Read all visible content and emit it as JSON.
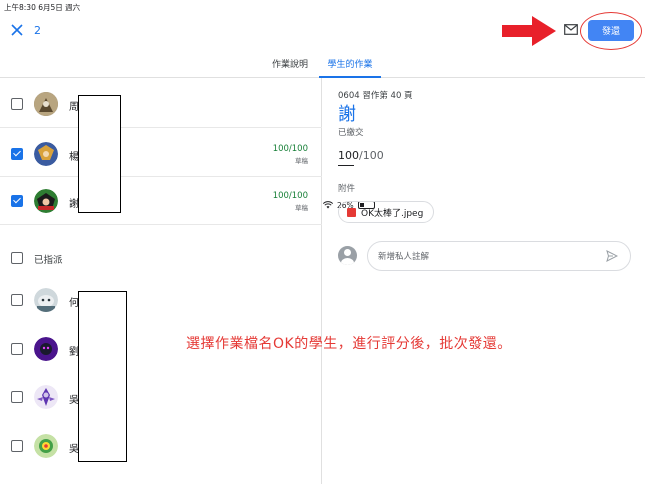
{
  "status_bar": {
    "time": "上午8:30  6月5日 週六",
    "battery": "26%"
  },
  "top_bar": {
    "selected_count": "2",
    "return_label": "發還"
  },
  "tabs": [
    {
      "label": "作業說明"
    },
    {
      "label": "學生的作業"
    }
  ],
  "students": [
    {
      "name": "周",
      "checked": false,
      "grade": "",
      "note": ""
    },
    {
      "name": "楊",
      "checked": true,
      "grade": "100/100",
      "note": "草稿"
    },
    {
      "name": "謝",
      "checked": true,
      "grade": "100/100",
      "note": "草稿"
    }
  ],
  "assigned_group": {
    "label": "已指派"
  },
  "assigned_students": [
    {
      "name": "何",
      "checked": false
    },
    {
      "name": "劉",
      "checked": false
    },
    {
      "name": "吳",
      "checked": false
    },
    {
      "name": "吳",
      "checked": false
    }
  ],
  "detail": {
    "assignment_title": "0604 習作第 40 頁",
    "student_name": "謝",
    "status": "已繳交",
    "score": "100",
    "out_of": "/100",
    "attachments_label": "附件",
    "attachment": "OK太棒了.jpeg",
    "comment_placeholder": "新增私人註解"
  },
  "annotation": "選擇作業檔名OK的學生，進行評分後，批次發還。",
  "colors": {
    "accent": "#1a73e8",
    "return_button": "#4285f4",
    "annotation": "#e53935",
    "grade": "#188038"
  }
}
